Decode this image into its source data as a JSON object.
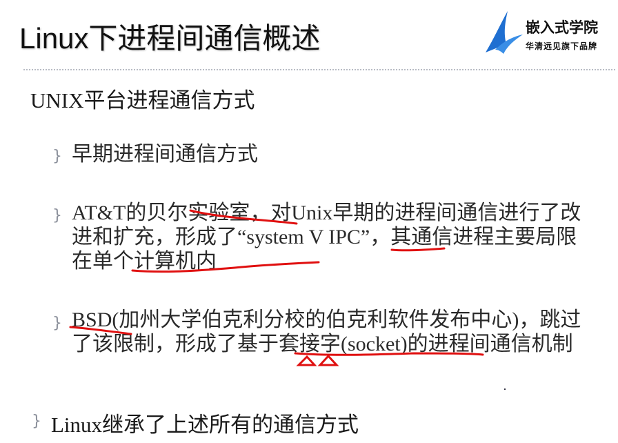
{
  "slide": {
    "title": "Linux下进程间通信概述",
    "heading": "UNIX平台进程通信方式",
    "items": [
      {
        "text": "早期进程间通信方式"
      },
      {
        "text": "AT&T的贝尔实验室，对Unix早期的进程间通信进行了改进和扩充，形成了“system V IPC”，其通信进程主要局限在单个计算机内"
      },
      {
        "text": "BSD(加州大学伯克利分校的伯克利软件发布中心)，跳过了该限制，形成了基于套接字(socket)的进程间通信机制"
      }
    ],
    "final": "Linux继承了上述所有的通信方式",
    "bullet_glyph": "}"
  },
  "logo": {
    "name": "嵌入式学院",
    "tagline": "华清远见旗下品牌",
    "color": "#1f6fd1"
  },
  "annotation_color": "#e01010"
}
